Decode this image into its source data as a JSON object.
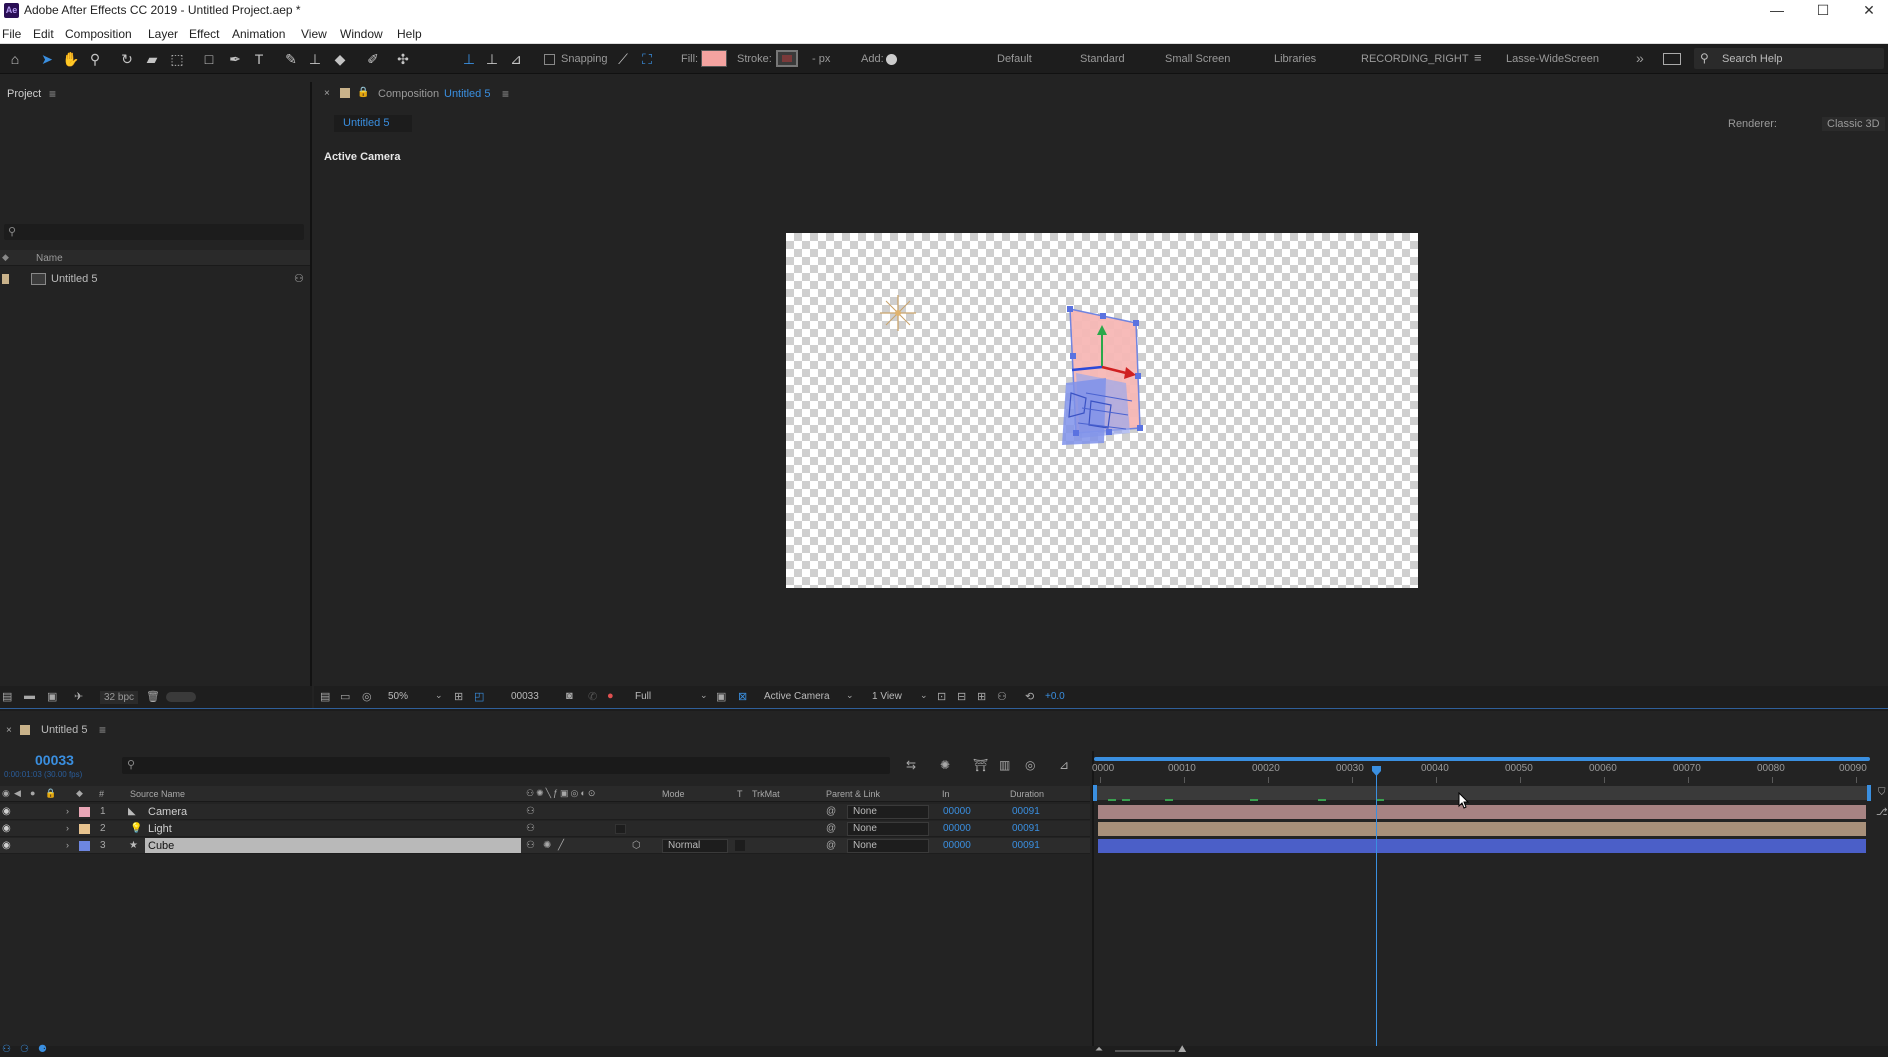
{
  "window": {
    "app_icon_text": "Ae",
    "title": "Adobe After Effects CC 2019 - Untitled Project.aep *",
    "minimize": "—",
    "maximize": "☐",
    "close": "✕"
  },
  "menu": [
    "File",
    "Edit",
    "Composition",
    "Layer",
    "Effect",
    "Animation",
    "View",
    "Window",
    "Help"
  ],
  "toolbar": {
    "snapping_label": "Snapping",
    "fill_label": "Fill:",
    "fill_color": "#f4a3a0",
    "stroke_label": "Stroke:",
    "stroke_units": "- px",
    "add_label": "Add:",
    "workspaces": [
      "Default",
      "Standard",
      "Small Screen",
      "Libraries",
      "RECORDING_RIGHT",
      "Lasse-WideScreen"
    ],
    "active_workspace": "RECORDING_RIGHT",
    "search_placeholder": "Search Help"
  },
  "project": {
    "title": "Project",
    "column_name": "Name",
    "item_name": "Untitled 5",
    "bpc": "32 bpc"
  },
  "composition": {
    "header_label": "Composition",
    "comp_name": "Untitled 5",
    "tab_label": "Untitled 5",
    "renderer_label": "Renderer:",
    "renderer_value": "Classic 3D",
    "view_label": "Active Camera",
    "zoom": "50%",
    "timecode": "00033",
    "resolution": "Full",
    "camera_dropdown": "Active Camera",
    "views_dropdown": "1 View",
    "exposure": "+0.0"
  },
  "timeline": {
    "tab_label": "Untitled 5",
    "current_time": "00033",
    "current_time_sub": "0:00:01:03 (30.00 fps)",
    "columns": {
      "source_name": "Source Name",
      "mode": "Mode",
      "t": "T",
      "trkmat": "TrkMat",
      "parent_link": "Parent & Link",
      "in": "In",
      "duration": "Duration"
    },
    "layers": [
      {
        "num": "1",
        "name": "Camera",
        "color": "#e9a6b6",
        "icon": "camera-icon",
        "mode": "",
        "parent": "None",
        "in": "00000",
        "duration": "00091"
      },
      {
        "num": "2",
        "name": "Light",
        "color": "#e8c38e",
        "icon": "light-icon",
        "mode": "",
        "parent": "None",
        "in": "00000",
        "duration": "00091"
      },
      {
        "num": "3",
        "name": "Cube",
        "color": "#6d86e0",
        "icon": "star-icon",
        "mode": "Normal",
        "parent": "None",
        "in": "00000",
        "duration": "00091"
      }
    ],
    "ruler": [
      "0000",
      "00010",
      "00020",
      "00030",
      "00040",
      "00050",
      "00060",
      "00070",
      "00080",
      "00090"
    ],
    "bar_colors": {
      "camera": "#a78383",
      "light": "#a8907a",
      "cube": "#4b5fc8"
    }
  }
}
